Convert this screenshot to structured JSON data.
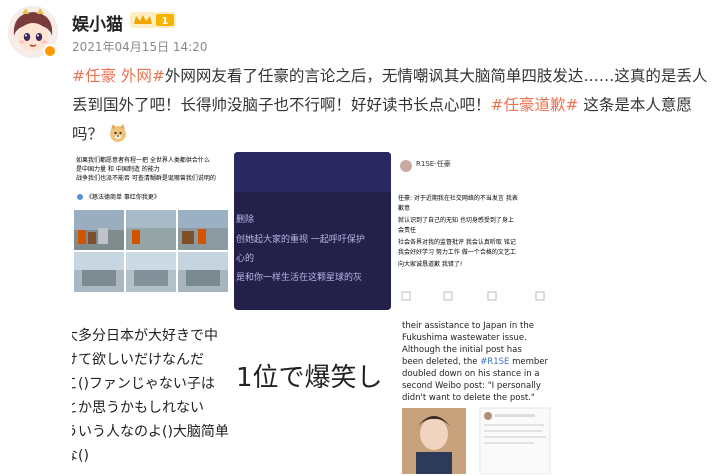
{
  "post": {
    "username": "娱小猫",
    "vip_level": "1",
    "timestamp": "2021年04月15日 14:20",
    "text_segments": [
      {
        "text": "#任豪 外网#",
        "type": "tag"
      },
      {
        "text": "外网网友看了任豪的言论之后，无情嘲讽其大脑简单四肢发达……这真的是丢人丢到国外了吧！长得帅没脑子也不行啊！好好读书长点心吧！",
        "type": "plain"
      },
      {
        "text": "#任豪道歉#",
        "type": "tag"
      },
      {
        "text": " 这条是本人意愿吗？",
        "type": "plain"
      }
    ]
  },
  "images": {
    "img1": {
      "lines": [
        "如果我们都愿意者有程一把 全世界人类都供合什么",
        "是中国力量 和 中国制造 的能力",
        "战争我们也派不能否 可查清糊群是诞哪曾我们说明的"
      ],
      "caption": "《慈法德商单 事红你我更》"
    },
    "img2": {
      "lines": [
        "删除",
        "创她起大家的重视 一起呼吁保护",
        "心的",
        "是和你一样生活在这颗星球的灰"
      ]
    },
    "img3": {
      "name": "R1SE-任豪",
      "lines": [
        "任豪: 对于近期我在社交网络的不当发言 我表",
        "歉意",
        "就认识到了自己的无知 也切身感受到了身上",
        "会责任",
        "社会各界对我的监督批评 我会认真听取 铭记",
        "我会好好学习 努力工作 做一个合格的文艺工",
        "向大家诚恳道歉 我错了!"
      ]
    },
    "img4": {
      "lines": [
        "大多分日本が大好きで中",
        "けて欲しいだけなんだ",
        "こ()ファンじゃない子は",
        "とか思うかもしれない",
        "ういう人なのよ()大脑简单",
        "な()"
      ]
    },
    "img5": {
      "text": "1位で爆笑し"
    },
    "img6": {
      "lines": [
        "their assistance to Japan in the",
        "Fukushima wastewater issue.",
        "Although the initial post has",
        "been deleted, the ",
        "#R1SE",
        " member",
        "doubled down on his stance in a",
        "second Weibo post: \"I personally",
        "didn't want to delete the post.\""
      ]
    }
  },
  "colors": {
    "tag": "#eb7350",
    "text": "#333333",
    "muted": "#8a8a8a"
  }
}
